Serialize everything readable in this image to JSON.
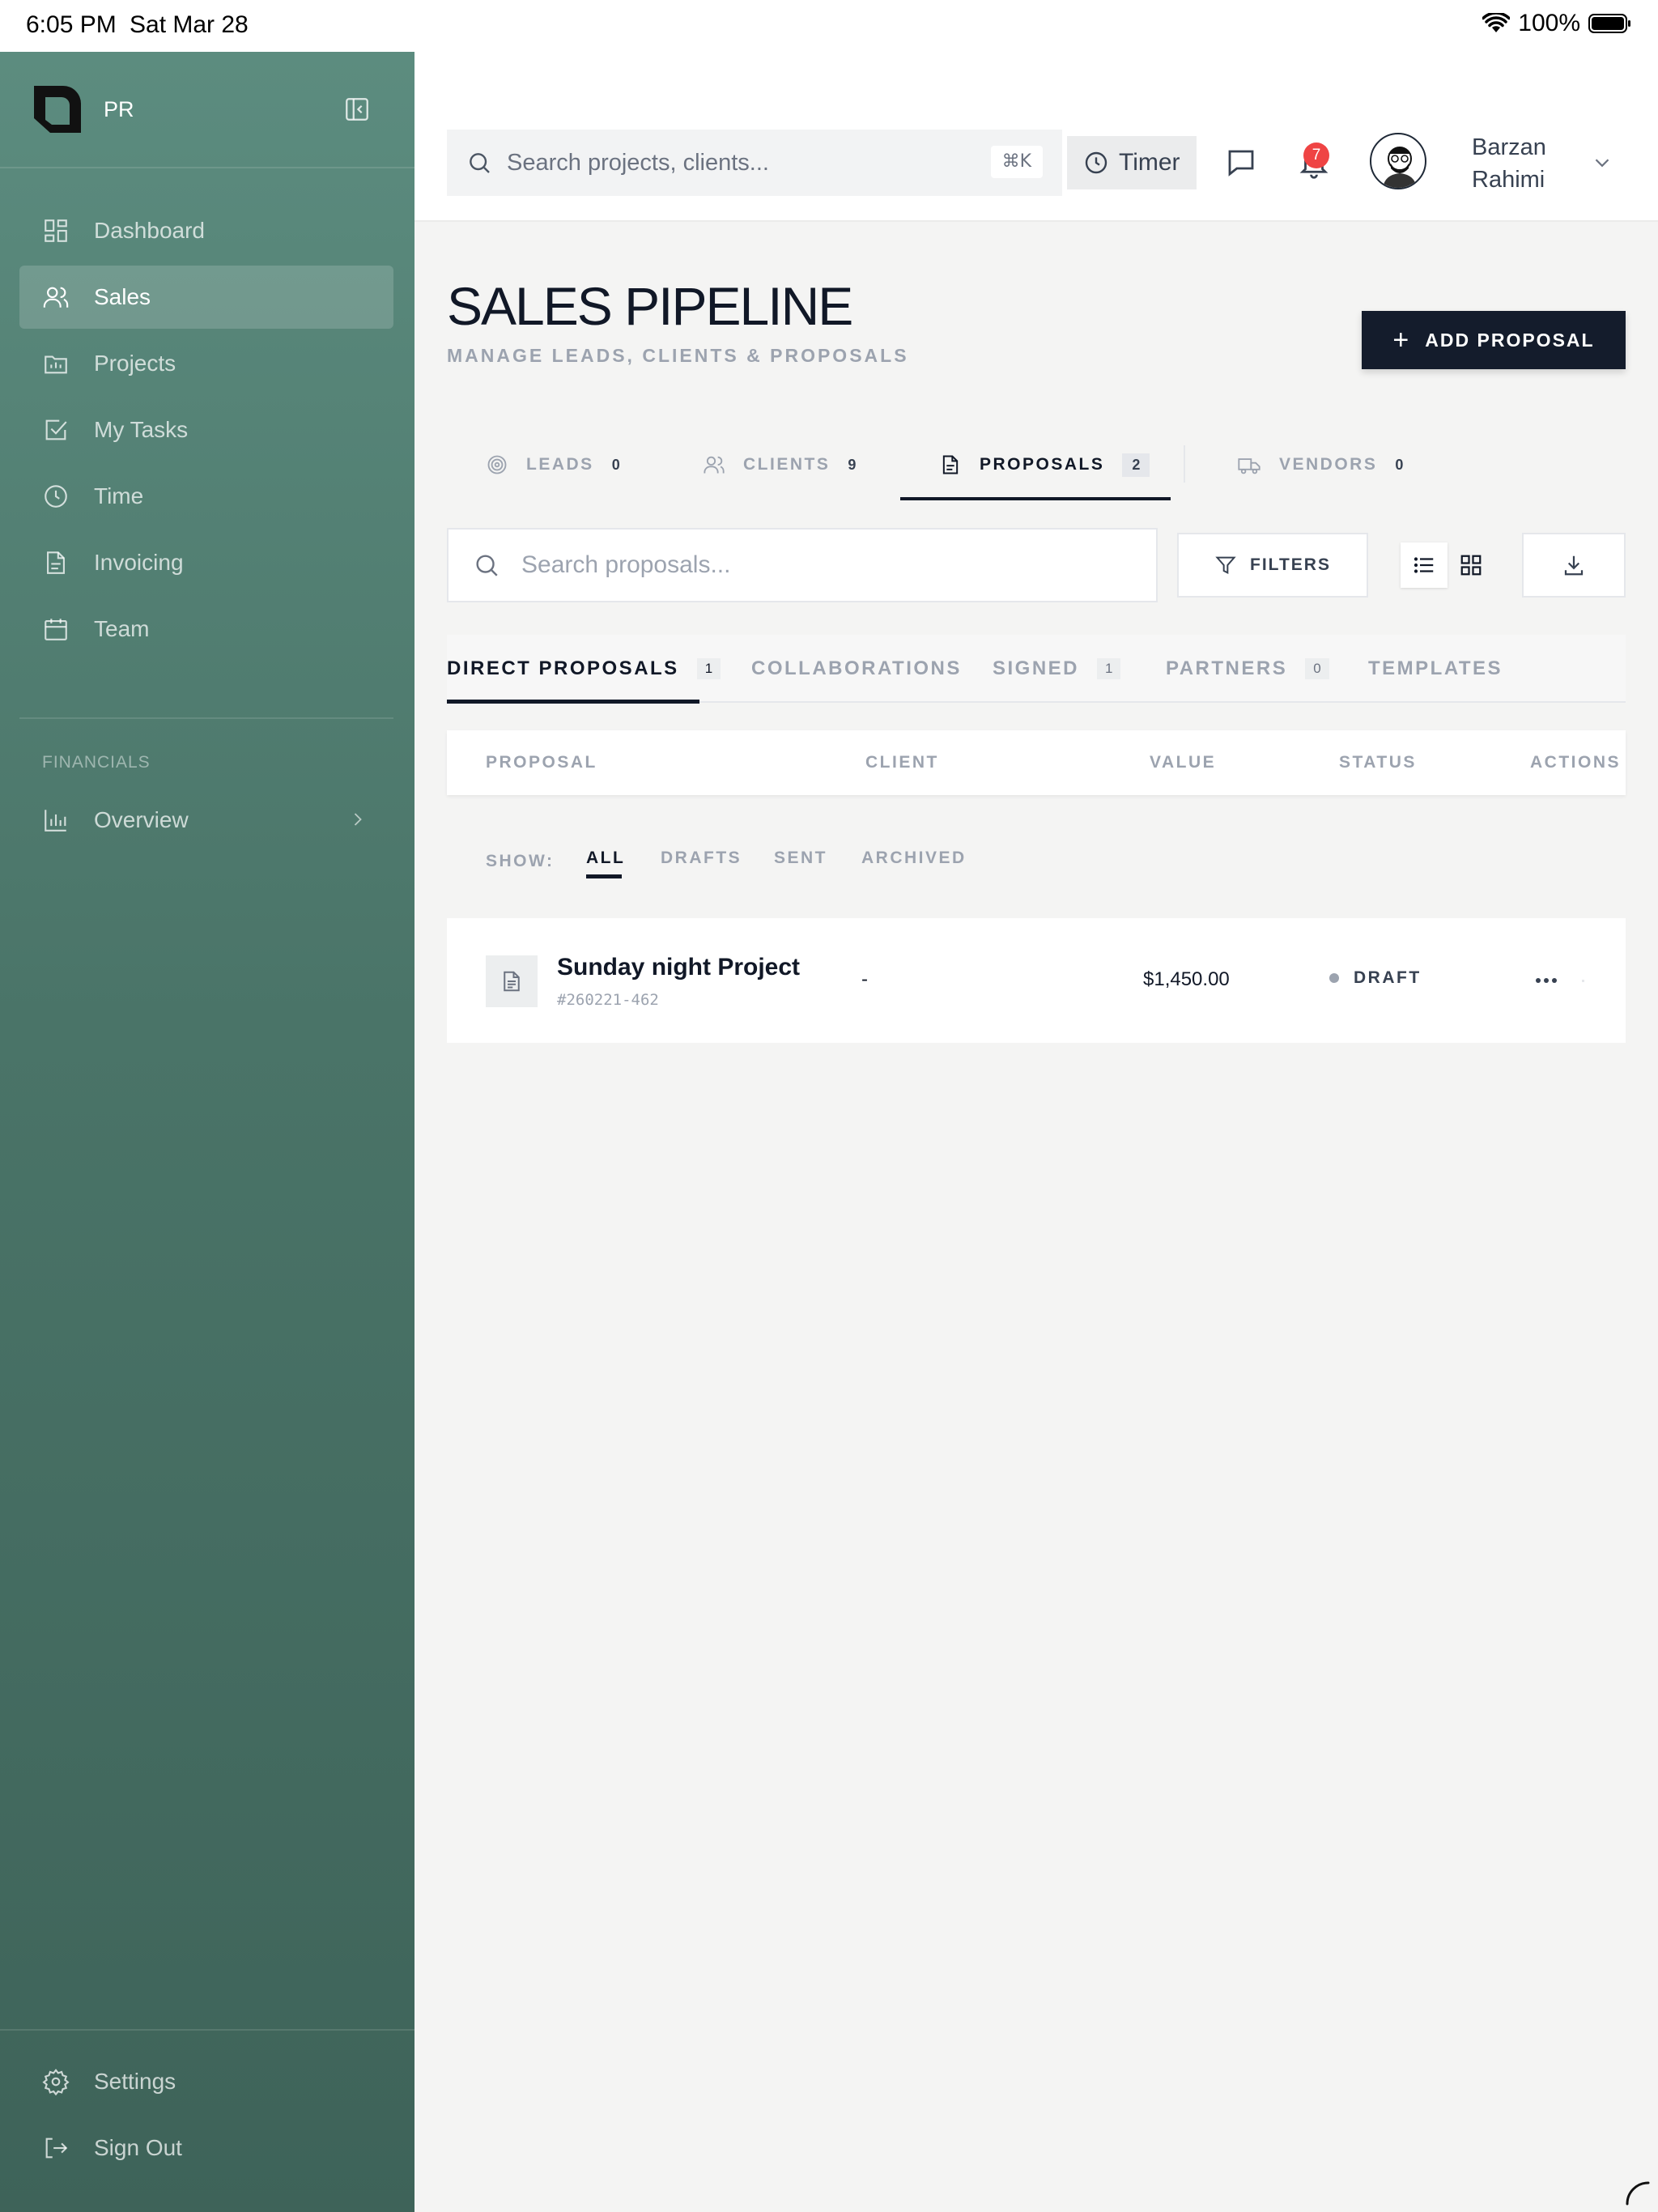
{
  "status_bar": {
    "time": "6:05 PM",
    "date": "Sat Mar 28",
    "battery": "100%"
  },
  "sidebar": {
    "brand": "PR",
    "items": [
      {
        "label": "Dashboard",
        "icon": "grid-icon"
      },
      {
        "label": "Sales",
        "icon": "users-icon",
        "active": true
      },
      {
        "label": "Projects",
        "icon": "folder-icon"
      },
      {
        "label": "My Tasks",
        "icon": "check-square-icon"
      },
      {
        "label": "Time",
        "icon": "clock-icon"
      },
      {
        "label": "Invoicing",
        "icon": "file-text-icon"
      },
      {
        "label": "Team",
        "icon": "calendar-icon"
      }
    ],
    "section_label": "FINANCIALS",
    "financials": [
      {
        "label": "Overview",
        "icon": "bar-chart-icon"
      }
    ],
    "footer": [
      {
        "label": "Settings",
        "icon": "gear-icon"
      },
      {
        "label": "Sign Out",
        "icon": "sign-out-icon"
      }
    ]
  },
  "header": {
    "search_placeholder": "Search projects, clients...",
    "shortcut": "⌘K",
    "timer_label": "Timer",
    "notification_count": "7",
    "user_first": "Barzan",
    "user_last": "Rahimi"
  },
  "page": {
    "title": "SALES PIPELINE",
    "subtitle": "MANAGE LEADS, CLIENTS & PROPOSALS",
    "add_button": "ADD PROPOSAL"
  },
  "tabs": [
    {
      "label": "LEADS",
      "count": "0"
    },
    {
      "label": "CLIENTS",
      "count": "9"
    },
    {
      "label": "PROPOSALS",
      "count": "2",
      "active": true
    },
    {
      "label": "VENDORS",
      "count": "0"
    }
  ],
  "toolbar": {
    "search_placeholder": "Search proposals...",
    "filters_label": "FILTERS"
  },
  "subtabs": [
    {
      "label": "DIRECT PROPOSALS",
      "count": "1",
      "active": true
    },
    {
      "label": "COLLABORATIONS",
      "count": ""
    },
    {
      "label": "SIGNED",
      "count": "1"
    },
    {
      "label": "PARTNERS",
      "count": "0"
    },
    {
      "label": "TEMPLATES",
      "count": ""
    }
  ],
  "table": {
    "columns": [
      "PROPOSAL",
      "CLIENT",
      "VALUE",
      "STATUS",
      "ACTIONS"
    ],
    "show_label": "SHOW:",
    "show_filters": [
      "ALL",
      "DRAFTS",
      "SENT",
      "ARCHIVED"
    ],
    "rows": [
      {
        "name": "Sunday night Project",
        "id": "#260221-462",
        "client": "-",
        "value": "$1,450.00",
        "status": "DRAFT"
      }
    ]
  },
  "colors": {
    "sidebar_top": "#5c8c7f",
    "sidebar_bottom": "#3e6359",
    "primary_button": "#141c2c",
    "badge": "#ef4444"
  }
}
